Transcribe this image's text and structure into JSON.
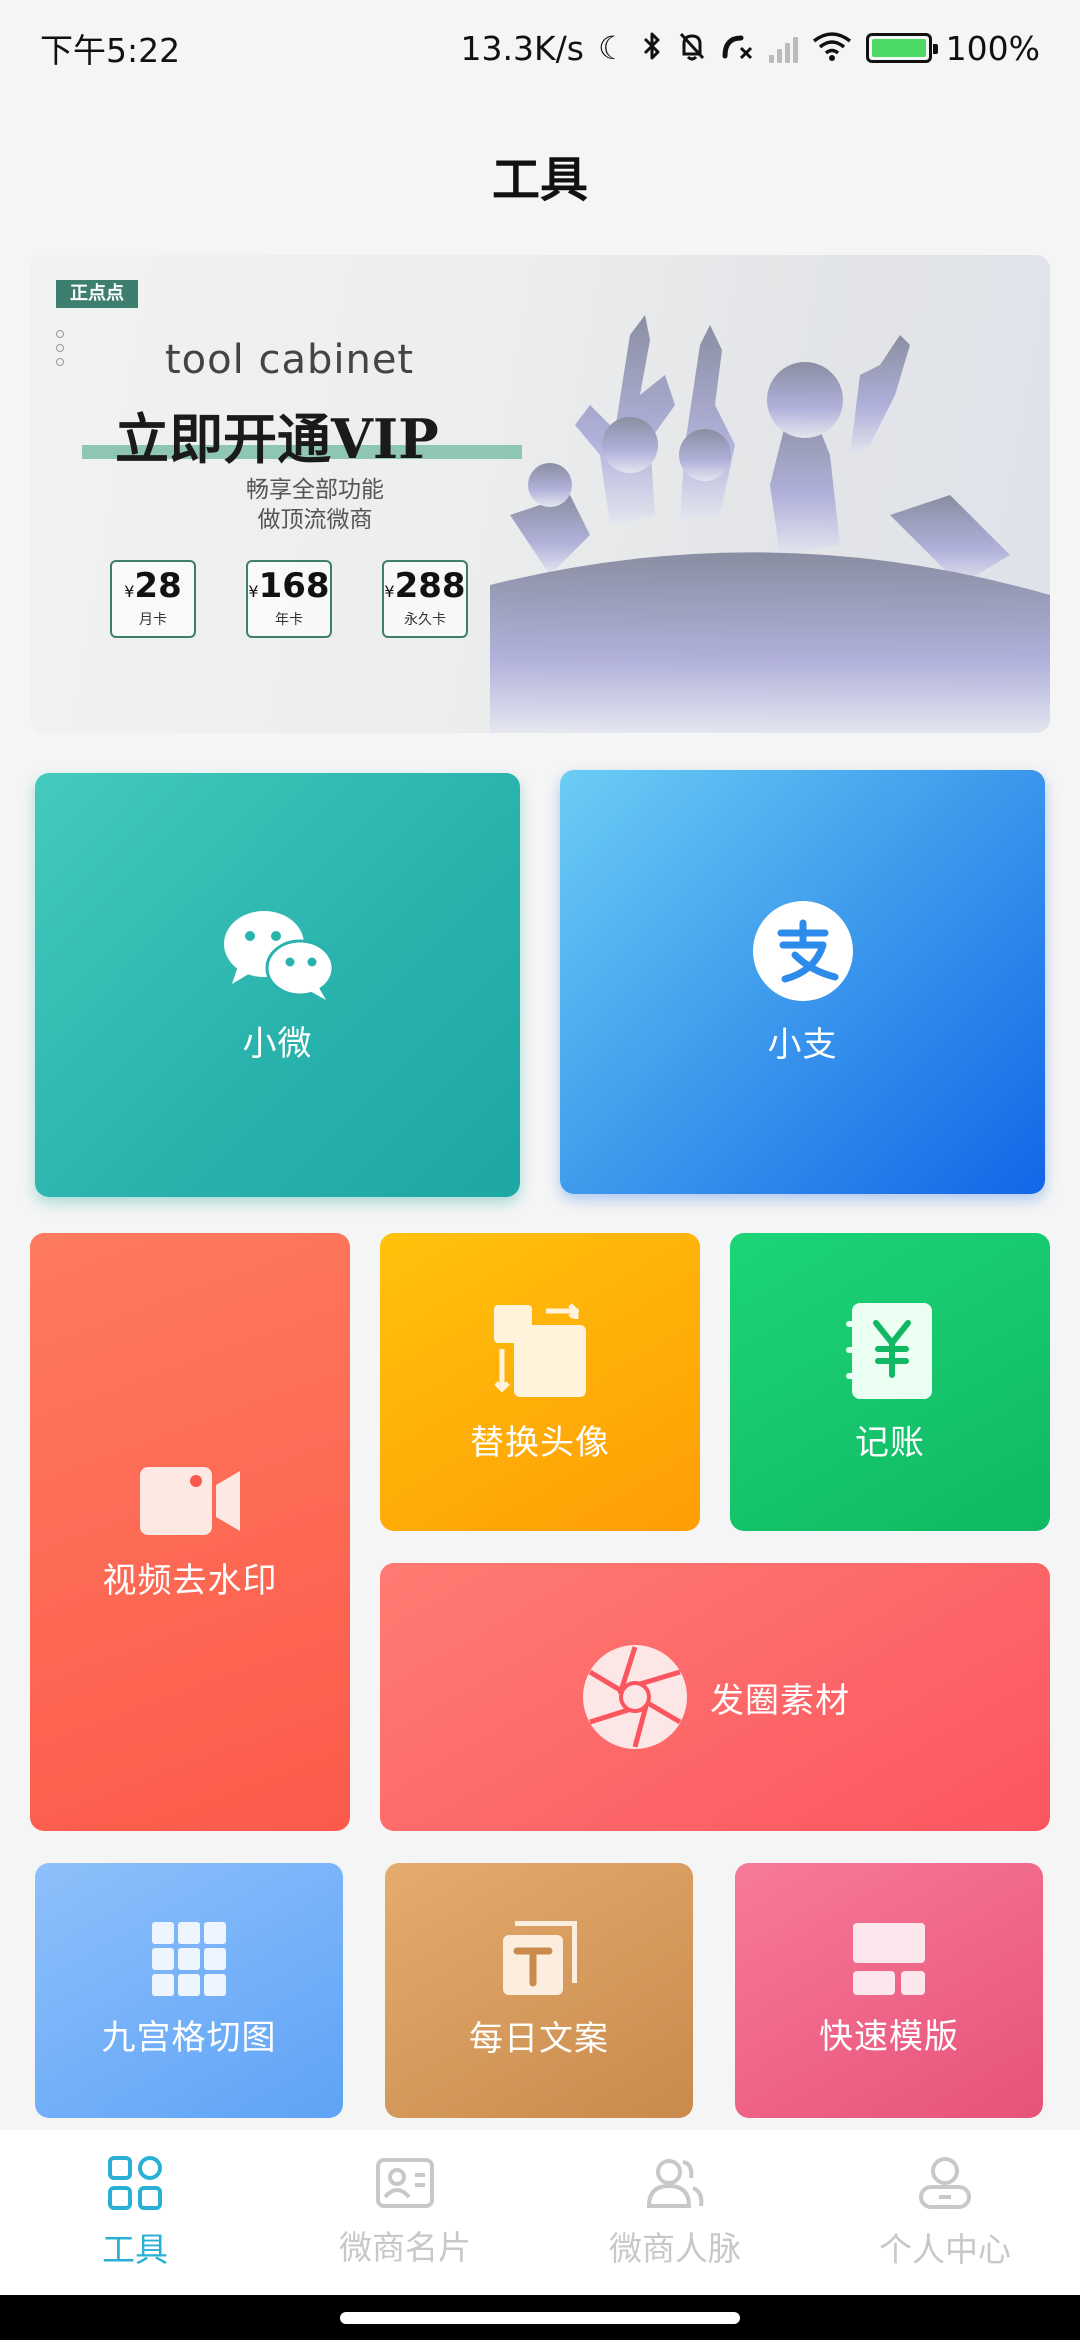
{
  "status_bar": {
    "time": "下午5:22",
    "net_speed": "13.3K/s",
    "battery": "100%"
  },
  "header": {
    "title": "工具"
  },
  "banner": {
    "tag": "正点点",
    "subtitle_en": "tool cabinet",
    "title": "立即开通VIP",
    "desc_line1": "畅享全部功能",
    "desc_line2": "做顶流微商",
    "currency": "¥",
    "prices": [
      {
        "amount": "28",
        "label": "月卡"
      },
      {
        "amount": "168",
        "label": "年卡"
      },
      {
        "amount": "288",
        "label": "永久卡"
      }
    ]
  },
  "tiles": {
    "wechat": "小微",
    "alipay": "小支",
    "video_watermark": "视频去水印",
    "replace_avatar": "替换头像",
    "ledger": "记账",
    "moments_material": "发圈素材",
    "grid9": "九宫格切图",
    "daily_copy": "每日文案",
    "quick_template": "快速模版"
  },
  "bottom_nav": {
    "items": [
      {
        "label": "工具",
        "icon": "tools-grid-icon",
        "active": true
      },
      {
        "label": "微商名片",
        "icon": "contact-card-icon",
        "active": false
      },
      {
        "label": "微商人脉",
        "icon": "contacts-people-icon",
        "active": false
      },
      {
        "label": "个人中心",
        "icon": "profile-icon",
        "active": false
      }
    ]
  },
  "colors": {
    "accent": "#2ab0d4",
    "wechat_tile": "#2ab3ad",
    "alipay_tile": "#3c99ec",
    "video_tile": "#fb5a4a",
    "avatar_tile": "#ff9d05",
    "ledger_tile": "#10b863",
    "moments_tile": "#fb5660",
    "grid9_tile": "#5ea3f6",
    "copy_tile": "#c98a4b",
    "template_tile": "#e75279"
  }
}
